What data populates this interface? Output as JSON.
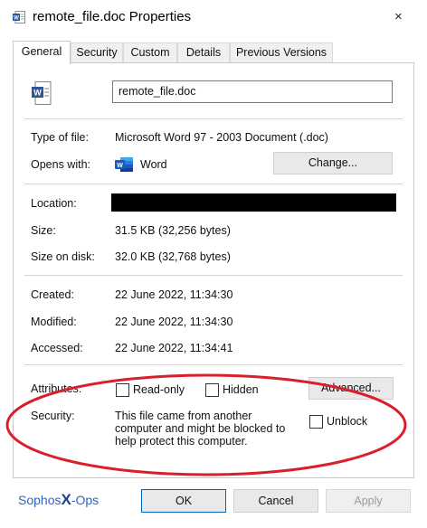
{
  "window": {
    "title": "remote_file.doc Properties",
    "close_glyph": "×"
  },
  "tabs": [
    {
      "label": "General",
      "active": true
    },
    {
      "label": "Security"
    },
    {
      "label": "Custom"
    },
    {
      "label": "Details"
    },
    {
      "label": "Previous Versions"
    }
  ],
  "general": {
    "filename": "remote_file.doc",
    "type_label": "Type of file:",
    "type_value": "Microsoft Word 97 - 2003 Document (.doc)",
    "opens_label": "Opens with:",
    "opens_value": "Word",
    "change_button": "Change...",
    "location_label": "Location:",
    "location_value": "",
    "size_label": "Size:",
    "size_value": "31.5 KB (32,256 bytes)",
    "size_disk_label": "Size on disk:",
    "size_disk_value": "32.0 KB (32,768 bytes)",
    "created_label": "Created:",
    "created_value": "22 June 2022, 11:34:30",
    "modified_label": "Modified:",
    "modified_value": "22 June 2022, 11:34:30",
    "accessed_label": "Accessed:",
    "accessed_value": "22 June 2022, 11:34:41",
    "attributes_label": "Attributes:",
    "readonly_label": "Read-only",
    "hidden_label": "Hidden",
    "advanced_button": "Advanced...",
    "security_label": "Security:",
    "security_text": "This file came from another computer and might be blocked to help protect this computer.",
    "unblock_label": "Unblock"
  },
  "footer": {
    "brand_left": "Sophos",
    "brand_x": "X",
    "brand_right": "-Ops",
    "ok_button": "OK",
    "cancel_button": "Cancel",
    "apply_button": "Apply"
  },
  "colors": {
    "accent_red": "#d9202a",
    "brand_blue": "#2b62c9",
    "word_blue": "#185abd"
  }
}
